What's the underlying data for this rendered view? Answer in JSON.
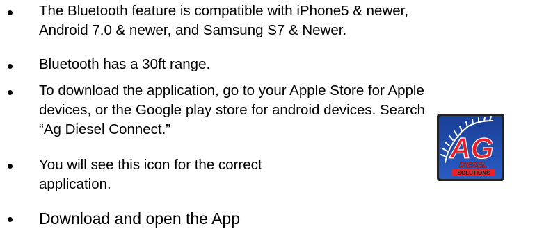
{
  "bullets": [
    {
      "text": "The Bluetooth feature is compatible with iPhone5 & newer,\nAndroid 7.0 & newer, and Samsung S7 & Newer."
    },
    {
      "text": "Bluetooth has a 30ft range."
    },
    {
      "text": "To download the application, go to your Apple Store for Apple\ndevices, or the Google play store for android devices. Search\n“Ag Diesel Connect.”"
    },
    {
      "text": "You will see this icon for the correct\napplication."
    },
    {
      "text": "Download and open the App"
    }
  ],
  "app_icon": {
    "icon": "ag-diesel-solutions-app-icon",
    "logo_text_main": "AG",
    "logo_text_sub1": "DIESEL",
    "logo_text_sub2": "SOLUTIONS",
    "colors": {
      "background": "#1f4aa8",
      "accent": "#e8202a",
      "text_dark": "#1a1a1a"
    }
  }
}
